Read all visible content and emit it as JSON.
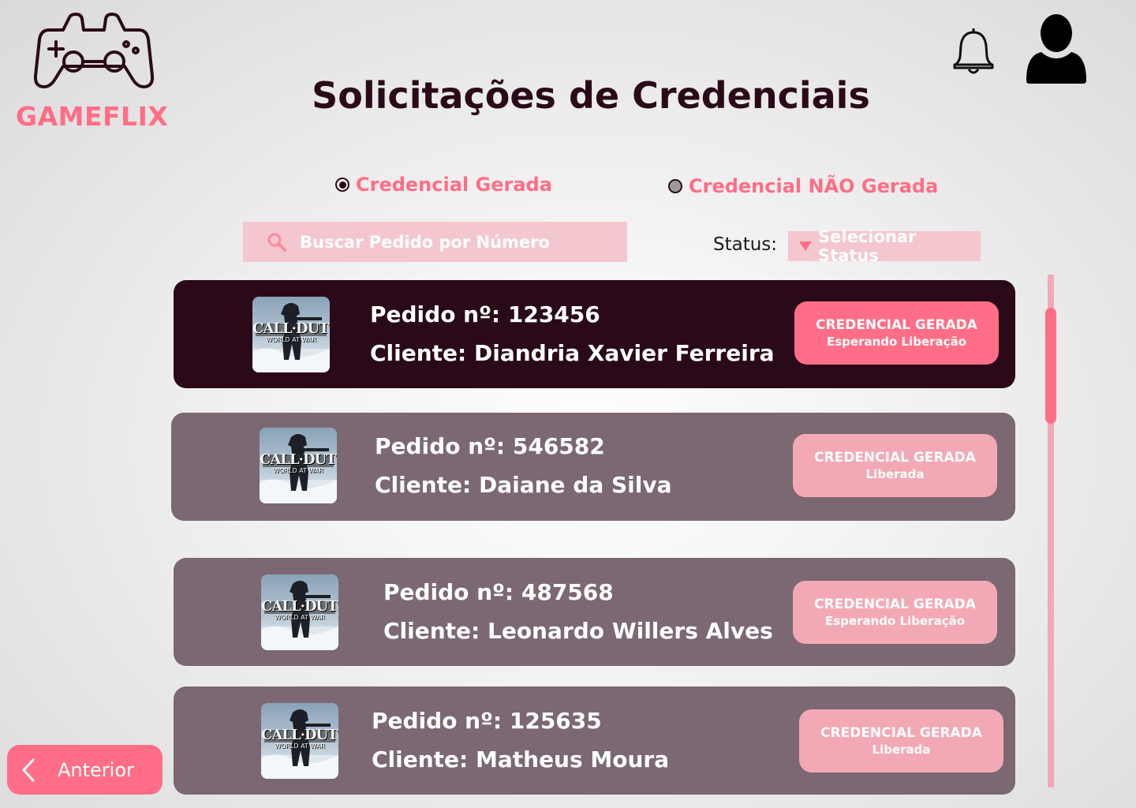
{
  "app": {
    "logo_text": "GAMEFLIX"
  },
  "page": {
    "title": "Solicitações de Credenciais"
  },
  "filters": {
    "radio_generated": "Credencial Gerada",
    "radio_not_generated": "Credencial NÃO Gerada",
    "selected": "Credencial Gerada"
  },
  "search": {
    "placeholder": "Buscar Pedido por Número",
    "value": ""
  },
  "status": {
    "label": "Status:",
    "select_placeholder": "Selecionar Status"
  },
  "orders": [
    {
      "pedido": "Pedido nº: 123456",
      "cliente": "Cliente: Diandria Xavier Ferreira",
      "badge_title": "CREDENCIAL GERADA",
      "badge_status": "Esperando Liberação",
      "game": "CALL OF DUTY WORLD AT WAR",
      "active": true
    },
    {
      "pedido": "Pedido nº: 546582",
      "cliente": "Cliente: Daiane da Silva",
      "badge_title": "CREDENCIAL GERADA",
      "badge_status": "Liberada",
      "game": "CALL OF DUTY WORLD AT WAR",
      "active": false
    },
    {
      "pedido": "Pedido nº: 487568",
      "cliente": "Cliente: Leonardo Willers Alves",
      "badge_title": "CREDENCIAL GERADA",
      "badge_status": "Esperando Liberação",
      "game": "CALL OF DUTY WORLD AT WAR",
      "active": false
    },
    {
      "pedido": "Pedido nº: 125635",
      "cliente": "Cliente: Matheus Moura",
      "badge_title": "CREDENCIAL GERADA",
      "badge_status": "Liberada",
      "game": "CALL OF DUTY WORLD AT WAR",
      "active": false
    }
  ],
  "navigation": {
    "previous_label": "Anterior"
  },
  "colors": {
    "accent": "#ff6e86",
    "accent_soft": "#f3a9b5",
    "dark": "#2a0a18",
    "card": "#7b6873"
  },
  "icons": {
    "logo": "gamepad-icon",
    "notifications": "bell-icon",
    "profile": "user-icon",
    "search": "search-icon",
    "dropdown": "caret-down-icon",
    "back": "chevron-left-icon"
  }
}
